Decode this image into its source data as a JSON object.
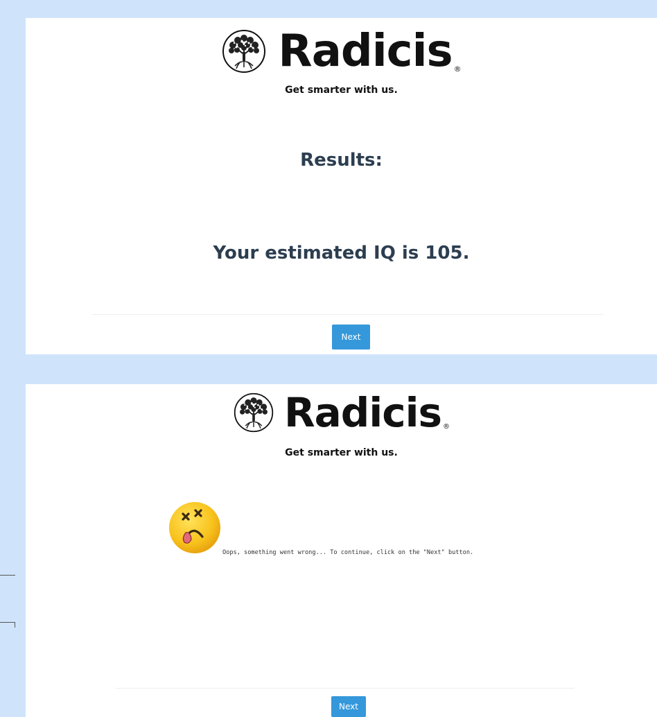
{
  "brand": {
    "name": "Radicis",
    "registered": "®",
    "tagline": "Get smarter with us."
  },
  "results_screen": {
    "heading": "Results:",
    "iq_message": "Your estimated IQ is 105.",
    "next_label": "Next"
  },
  "error_screen": {
    "emoji": "dizzy-face-tongue-emoji",
    "message": "Oops, something went wrong... To continue, click on the \"Next\" button.",
    "next_label": "Next"
  },
  "colors": {
    "background": "#cfe4fb",
    "heading_text": "#2c3e50",
    "button": "#3498db"
  }
}
